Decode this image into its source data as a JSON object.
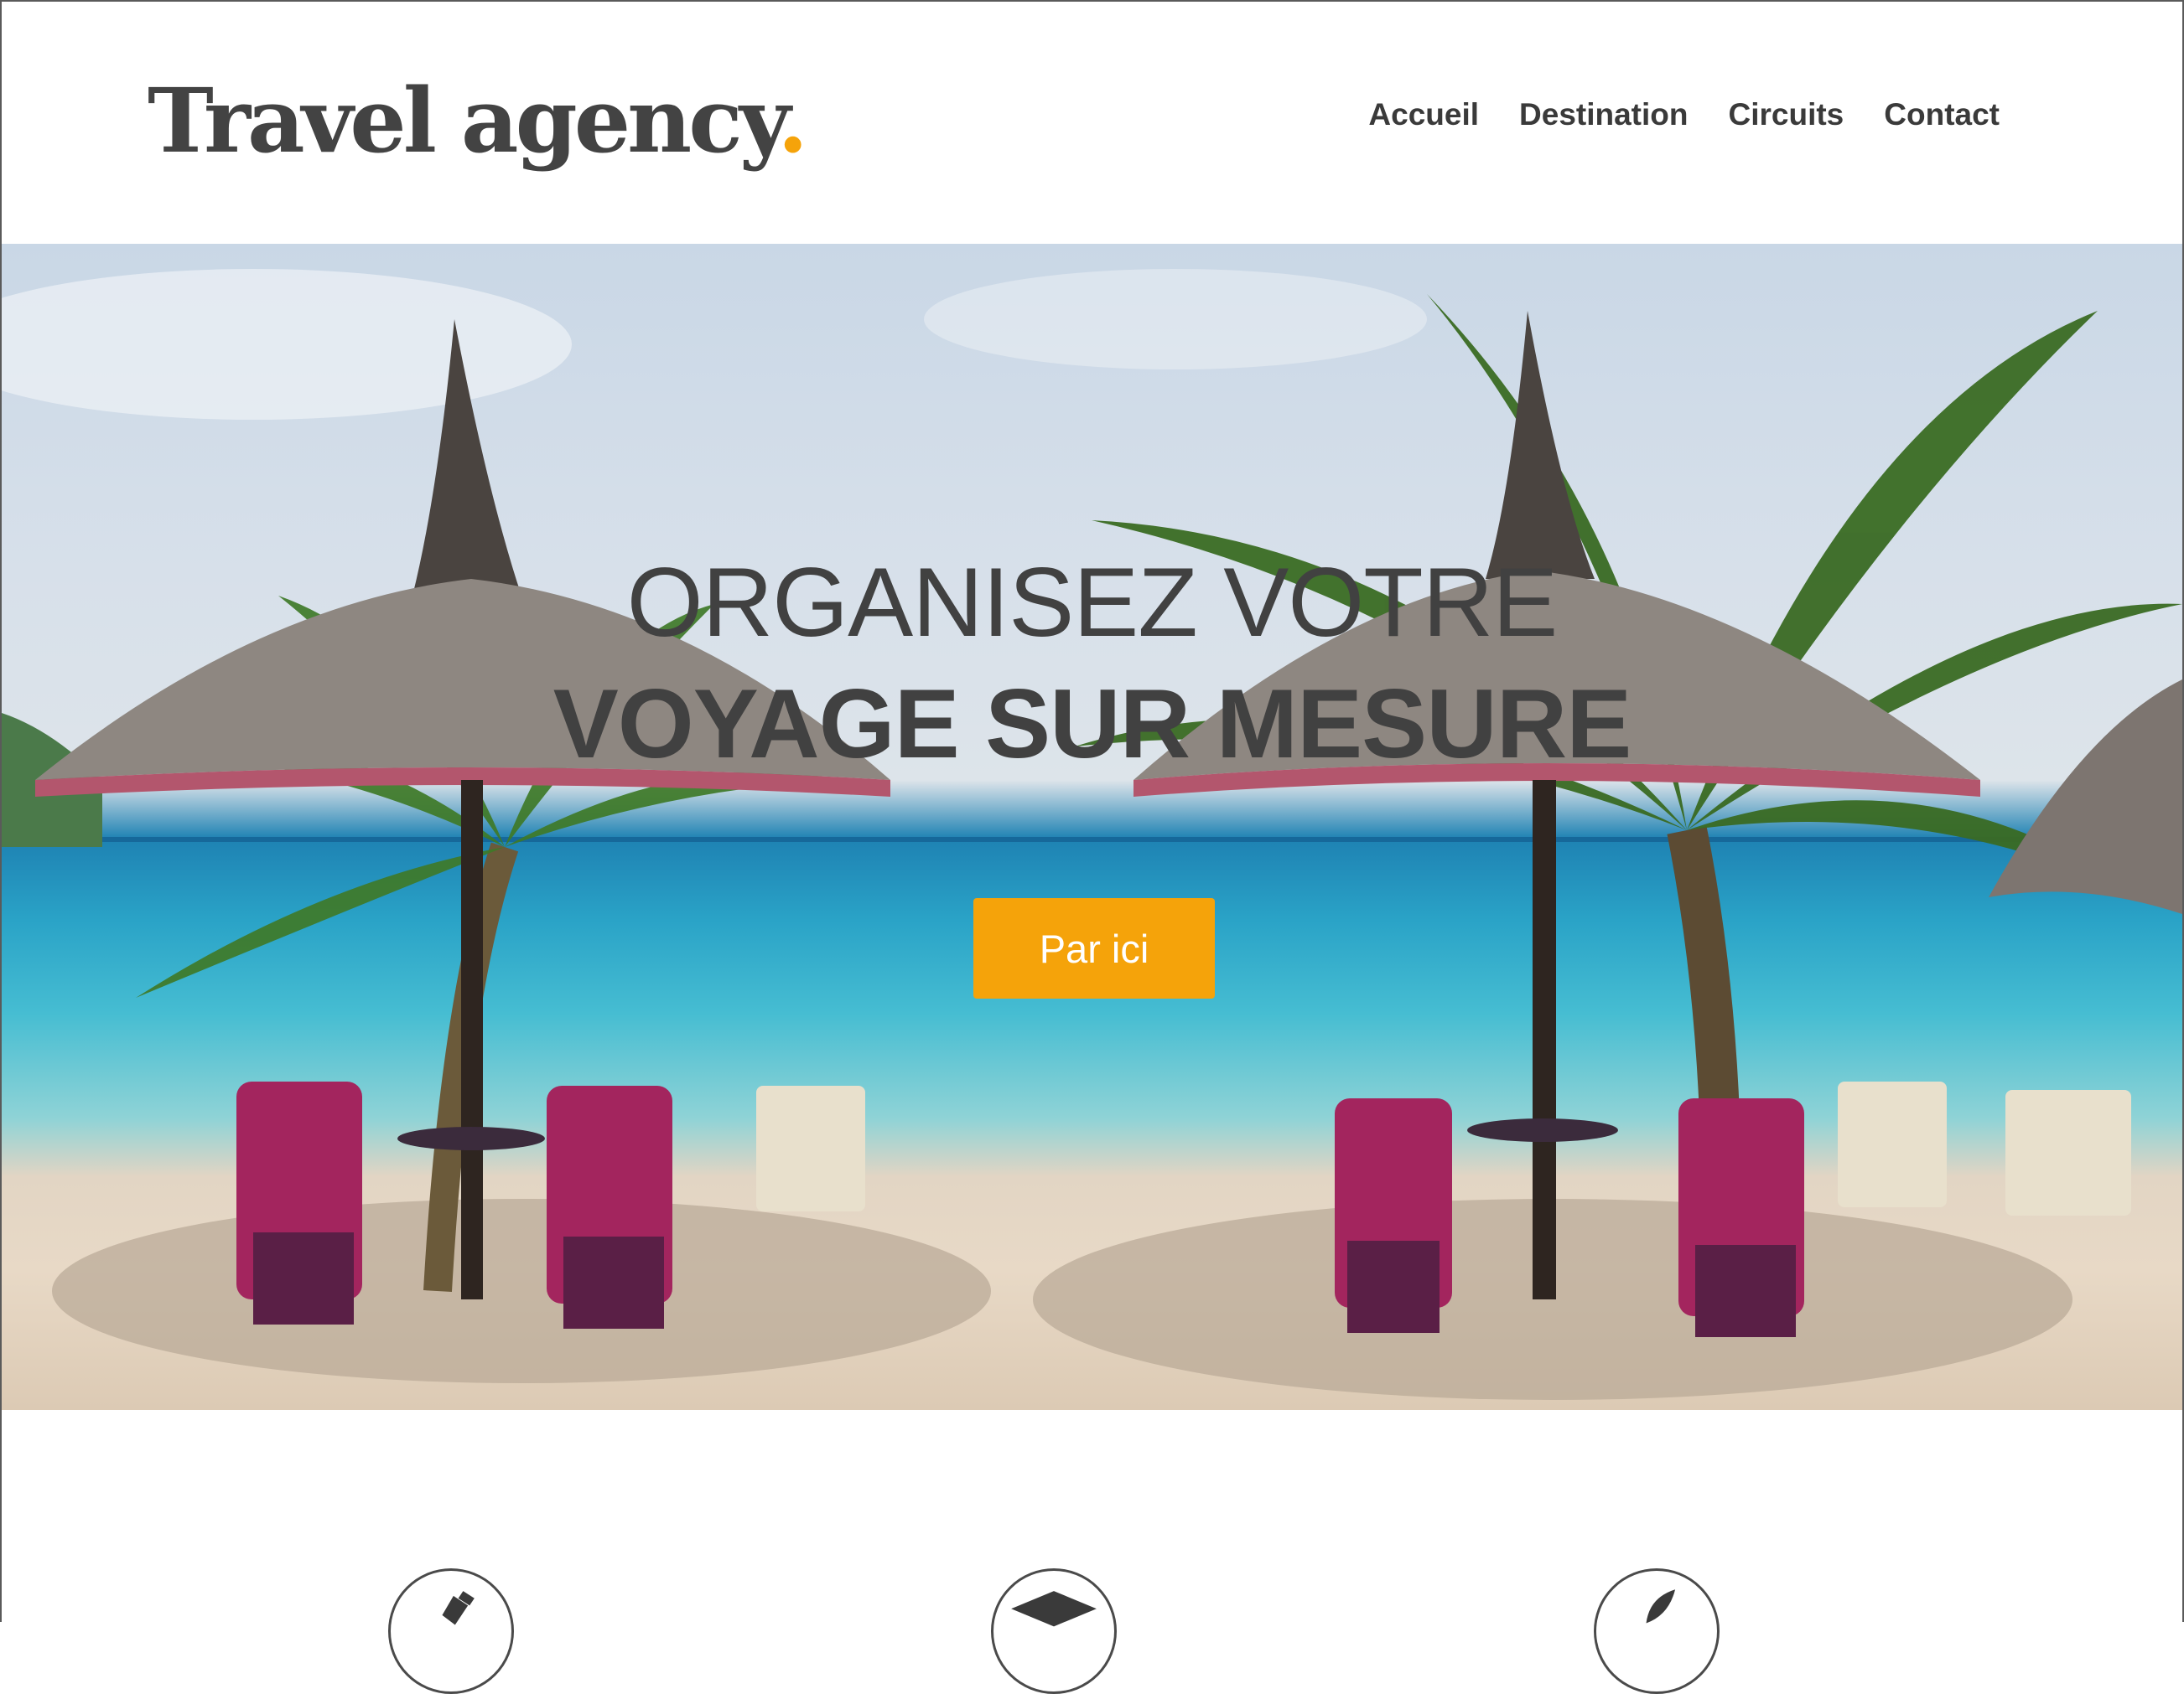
{
  "header": {
    "logo_text": "Travel agency",
    "logo_dot": ".",
    "nav": [
      "Accueil",
      "Destination",
      "Circuits",
      "Contact"
    ]
  },
  "hero": {
    "title_line1": "ORGANISEZ VOTRE",
    "title_line2": "VOYAGE SUR MESURE",
    "cta_label": "Par ici"
  },
  "features": {
    "icons": [
      "pencil-icon",
      "graduation-cap-icon",
      "rocket-icon"
    ]
  },
  "colors": {
    "accent": "#f5a30a",
    "text": "#434343"
  }
}
